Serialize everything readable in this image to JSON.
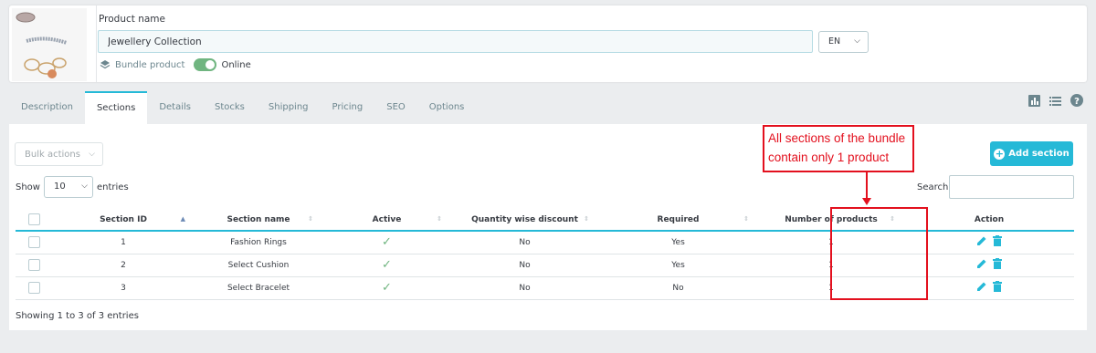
{
  "header": {
    "product_name_label": "Product name",
    "product_name_value": "Jewellery Collection",
    "language": "EN",
    "product_type": "Bundle product",
    "status_label": "Online",
    "status_on": true
  },
  "tabs": [
    {
      "label": "Description",
      "active": false
    },
    {
      "label": "Sections",
      "active": true
    },
    {
      "label": "Details",
      "active": false
    },
    {
      "label": "Stocks",
      "active": false
    },
    {
      "label": "Shipping",
      "active": false
    },
    {
      "label": "Pricing",
      "active": false
    },
    {
      "label": "SEO",
      "active": false
    },
    {
      "label": "Options",
      "active": false
    }
  ],
  "toolbar": {
    "bulk_actions": "Bulk actions",
    "add_section": "Add section",
    "show_label": "Show",
    "entries_per_page": "10",
    "entries_label": "entries",
    "search_label": "Search"
  },
  "table": {
    "columns": [
      "Section ID",
      "Section name",
      "Active",
      "Quantity wise discount",
      "Required",
      "Number of products",
      "Action"
    ],
    "rows": [
      {
        "id": "1",
        "name": "Fashion Rings",
        "active": true,
        "qty_discount": "No",
        "required": "Yes",
        "num_products": "1"
      },
      {
        "id": "2",
        "name": "Select Cushion",
        "active": true,
        "qty_discount": "No",
        "required": "Yes",
        "num_products": "1"
      },
      {
        "id": "3",
        "name": "Select Bracelet",
        "active": true,
        "qty_discount": "No",
        "required": "No",
        "num_products": "1"
      }
    ],
    "footer": "Showing 1 to 3 of 3 entries"
  },
  "annotation": {
    "text_line1": "All sections of the bundle",
    "text_line2": "contain only 1 product",
    "color": "#e3101e"
  },
  "colors": {
    "accent": "#25b9d7",
    "success": "#70b580",
    "danger": "#e3101e"
  }
}
